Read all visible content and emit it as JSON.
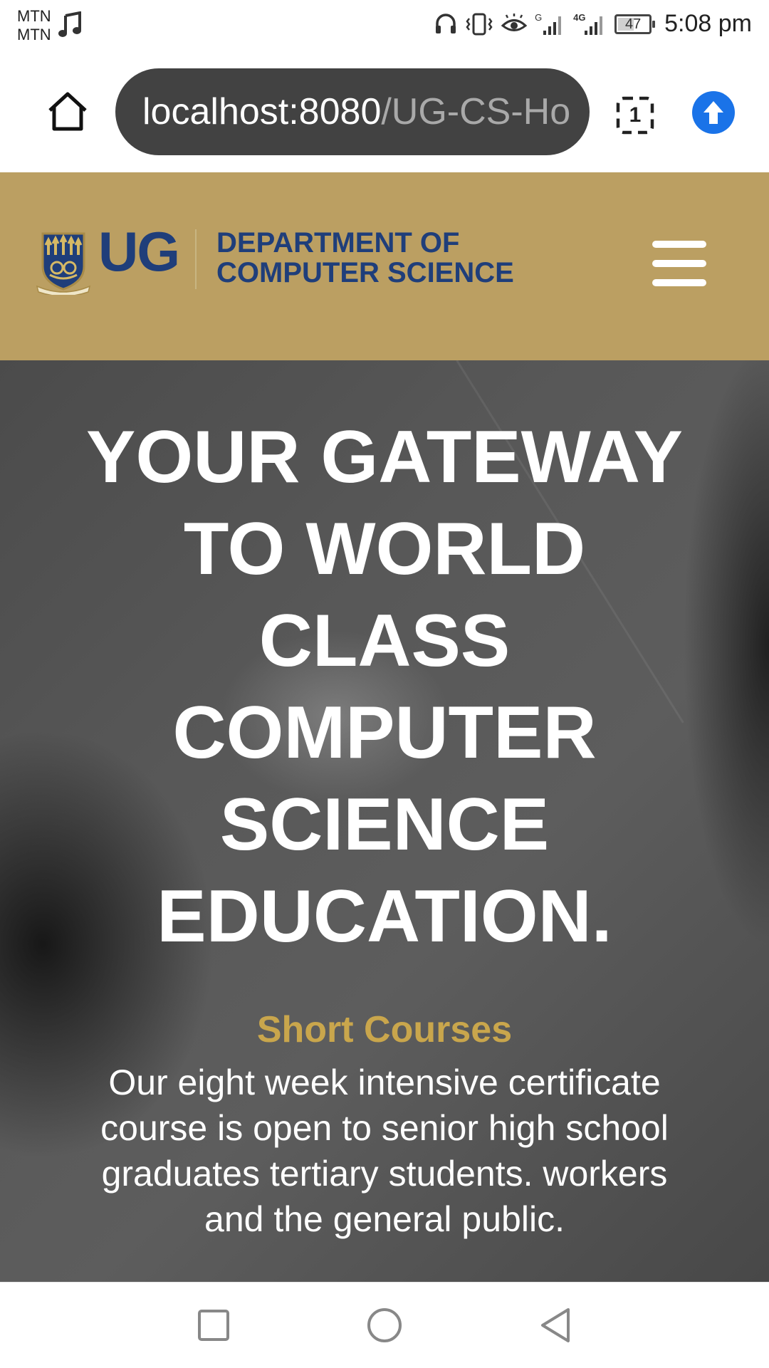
{
  "status_bar": {
    "carrier_1": "MTN",
    "carrier_2": "MTN",
    "network_1": "G",
    "network_2": "4G",
    "battery": "47",
    "time": "5:08 pm"
  },
  "browser": {
    "url_host": "localhost:8080",
    "url_path": "/UG-CS-Ho",
    "tab_count": "1",
    "icons": {
      "home": "home-icon",
      "tabs": "tab-switcher-icon",
      "update": "upload-arrow-icon"
    },
    "accent_color": "#1a73e8"
  },
  "site_header": {
    "logo_text": "UG",
    "dept_line_1": "DEPARTMENT OF",
    "dept_line_2": "COMPUTER SCIENCE",
    "background_color": "#bb9f62",
    "brand_color": "#1f3e7a",
    "menu_icon": "hamburger-menu-icon"
  },
  "hero": {
    "title_lines": [
      "YOUR GATEWAY",
      "TO WORLD",
      "CLASS",
      "COMPUTER",
      "SCIENCE",
      "EDUCATION."
    ],
    "subtitle": "Short Courses",
    "subtitle_color": "#c9a64c",
    "body": "Our eight week intensive certificate course is open to senior high school graduates tertiary students. workers and the general public."
  },
  "nav_bar": {
    "icons": [
      "recents-square-icon",
      "home-circle-icon",
      "back-triangle-icon"
    ]
  }
}
